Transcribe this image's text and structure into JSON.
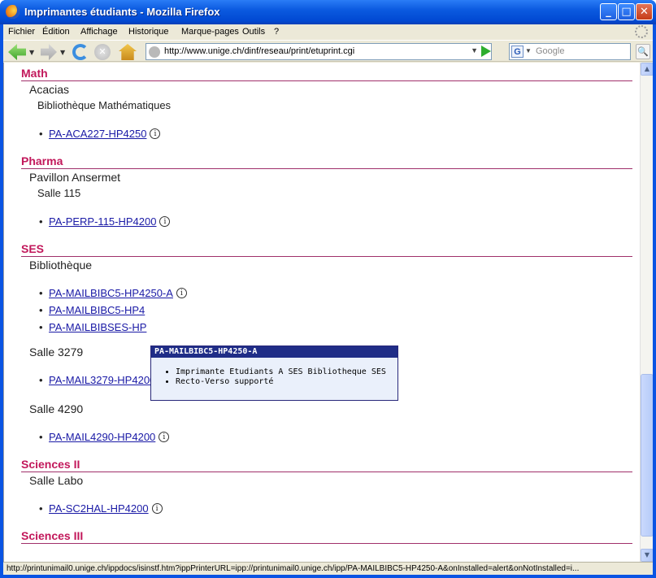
{
  "window": {
    "title": "Imprimantes étudiants - Mozilla Firefox",
    "min_label": "_",
    "max_label": "□",
    "close_label": "✕"
  },
  "menu": {
    "items": [
      "Fichier",
      "Édition",
      "Affichage",
      "Historique",
      "Marque-pages",
      "Outils",
      "?"
    ]
  },
  "nav": {
    "url": "http://www.unige.ch/dinf/reseau/print/etuprint.cgi",
    "search_placeholder": "Google",
    "stop_glyph": "✕",
    "search_glyph": "🔍",
    "search_engine_glyph": "G",
    "dropdown_glyph": "▼"
  },
  "sections": {
    "math": {
      "title": "Math",
      "building": "Acacias",
      "room": "Bibliothèque Mathématiques",
      "printers": [
        "PA-ACA227-HP4250"
      ]
    },
    "pharma": {
      "title": "Pharma",
      "building": "Pavillon Ansermet",
      "room": "Salle 115",
      "printers": [
        "PA-PERP-115-HP4200"
      ]
    },
    "ses": {
      "title": "SES",
      "building": "Bibliothèque",
      "printers": [
        "PA-MAILBIBC5-HP4250-A",
        "PA-MAILBIBC5-HP4",
        "PA-MAILBIBSES-HP"
      ],
      "room_3279": "Salle 3279",
      "printer_3279": "PA-MAIL3279-HP4200",
      "room_4290": "Salle 4290",
      "printer_4290": "PA-MAIL4290-HP4200"
    },
    "sciences2": {
      "title": "Sciences II",
      "building": "Salle Labo",
      "printers": [
        "PA-SC2HAL-HP4200"
      ]
    },
    "sciences3": {
      "title": "Sciences III"
    }
  },
  "info_glyph": "i",
  "bullet": "•",
  "tooltip": {
    "title": "PA-MAILBIBC5-HP4250-A",
    "lines": [
      "Imprimante Etudiants A SES Bibliotheque SES",
      "Recto-Verso supporté"
    ]
  },
  "status": {
    "text": "http://printunimail0.unige.ch/ippdocs/isinstf.htm?ippPrinterURL=ipp://printunimail0.unige.ch/ipp/PA-MAILBIBC5-HP4250-A&onInstalled=alert&onNotInstalled=i..."
  }
}
